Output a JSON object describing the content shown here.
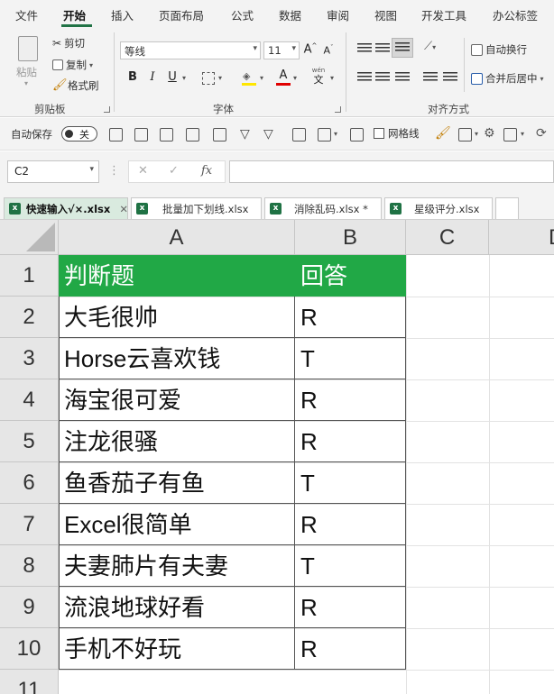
{
  "menu": {
    "tabs": [
      "文件",
      "开始",
      "插入",
      "页面布局",
      "公式",
      "数据",
      "审阅",
      "视图",
      "开发工具",
      "办公标签"
    ],
    "active": "开始"
  },
  "ribbon": {
    "clipboard": {
      "paste": "粘贴",
      "cut": "剪切",
      "copy": "复制",
      "format_painter": "格式刷",
      "label": "剪贴板"
    },
    "font": {
      "font_name": "等线",
      "font_size": "11",
      "grow": "A",
      "shrink": "A",
      "bold": "B",
      "italic": "I",
      "underline": "U",
      "phonetic": "文",
      "phonetic_top": "wén",
      "font_color_glyph": "A",
      "label": "字体"
    },
    "alignment": {
      "wrap_text": "自动换行",
      "merge_center": "合并后居中",
      "label": "对齐方式"
    }
  },
  "qat": {
    "autosave_label": "自动保存",
    "autosave_state": "关",
    "gridlines_label": "网格线"
  },
  "formula_bar": {
    "name_box": "C2",
    "formula": ""
  },
  "workbooks": [
    {
      "name": "快速输入√×.xlsx",
      "active": true,
      "closable": true
    },
    {
      "name": "批量加下划线.xlsx",
      "active": false,
      "closable": false
    },
    {
      "name": "消除乱码.xlsx *",
      "active": false,
      "closable": false
    },
    {
      "name": "星级评分.xlsx",
      "active": false,
      "closable": false
    }
  ],
  "sheet": {
    "columns": [
      "A",
      "B",
      "C",
      "D"
    ],
    "rows": [
      "1",
      "2",
      "3",
      "4",
      "5",
      "6",
      "7",
      "8",
      "9",
      "10",
      "11"
    ],
    "cells": [
      [
        "判断题",
        "回答"
      ],
      [
        "大毛很帅",
        "R"
      ],
      [
        "Horse云喜欢钱",
        "T"
      ],
      [
        "海宝很可爱",
        "R"
      ],
      [
        "注龙很骚",
        "R"
      ],
      [
        "鱼香茄子有鱼",
        "T"
      ],
      [
        "Excel很简单",
        "R"
      ],
      [
        "夫妻肺片有夫妻",
        "T"
      ],
      [
        "流浪地球好看",
        "R"
      ],
      [
        "手机不好玩",
        "R"
      ]
    ],
    "header_color": "#21a846"
  }
}
